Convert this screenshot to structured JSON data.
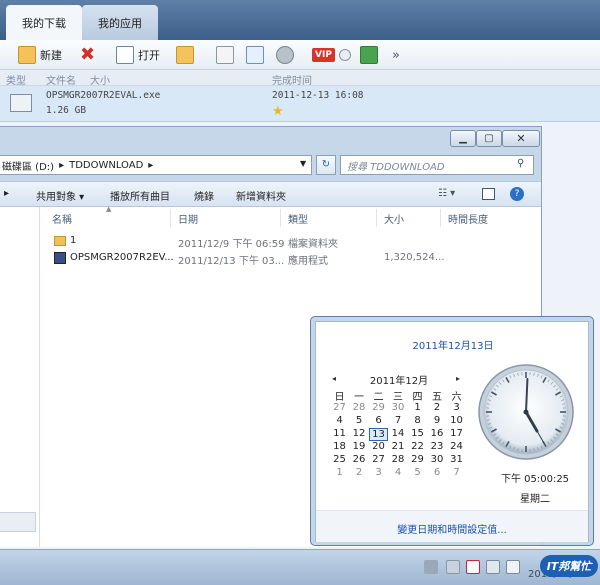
{
  "download_manager": {
    "tabs": [
      {
        "label": "我的下载"
      },
      {
        "label": "我的应用"
      }
    ],
    "toolbar": {
      "new_label": "新建",
      "open_label": "打开",
      "vip_label": "VIP",
      "more_label": "»"
    },
    "columns": {
      "type": "类型",
      "filename": "文件名",
      "size": "大小",
      "completed": "完成时间"
    },
    "row": {
      "filename": "OPSMGR2007R2EVAL.exe",
      "size": "1.26 GB",
      "completed": "2011-12-13 16:08"
    }
  },
  "explorer": {
    "address": {
      "drive": "磁碟區 (D:)",
      "sep": "▸",
      "folder": "TDDOWNLOAD",
      "sep2": "▸"
    },
    "search_placeholder": "搜尋 TDDOWNLOAD",
    "commands": {
      "share": "共用對象 ▾",
      "play_all": "播放所有曲目",
      "burn": "燒錄",
      "new_folder": "新增資料夾"
    },
    "columns": {
      "name": "名稱",
      "date": "日期",
      "type": "類型",
      "size": "大小",
      "duration": "時間長度"
    },
    "files": [
      {
        "name": "1",
        "date": "2011/12/9 下午 06:59",
        "type": "檔案資料夾",
        "size": ""
      },
      {
        "name": "OPSMGR2007R2EV...",
        "date": "2011/12/13 下午 03...",
        "type": "應用程式",
        "size": "1,320,524..."
      }
    ]
  },
  "calendar": {
    "full_date": "2011年12月13日",
    "month_label": "2011年12月",
    "prev": "◂",
    "next": "▸",
    "weekdays": [
      "日",
      "一",
      "二",
      "三",
      "四",
      "五",
      "六"
    ],
    "weeks": [
      [
        "27",
        "28",
        "29",
        "30",
        "1",
        "2",
        "3"
      ],
      [
        "4",
        "5",
        "6",
        "7",
        "8",
        "9",
        "10"
      ],
      [
        "11",
        "12",
        "13",
        "14",
        "15",
        "16",
        "17"
      ],
      [
        "18",
        "19",
        "20",
        "21",
        "22",
        "23",
        "24"
      ],
      [
        "25",
        "26",
        "27",
        "28",
        "29",
        "30",
        "31"
      ],
      [
        "1",
        "2",
        "3",
        "4",
        "5",
        "6",
        "7"
      ]
    ],
    "today": "13",
    "time": "下午 05:00:25",
    "weekday": "星期二",
    "clock": {
      "hour": 5,
      "minute": 0,
      "second": 25
    },
    "link": "變更日期和時間設定值..."
  },
  "taskbar": {
    "date": "2011/12/13",
    "logo_text": "IT邦幫忙"
  },
  "colors": {
    "accent": "#1c53a6",
    "today_border": "#2b66b3"
  }
}
